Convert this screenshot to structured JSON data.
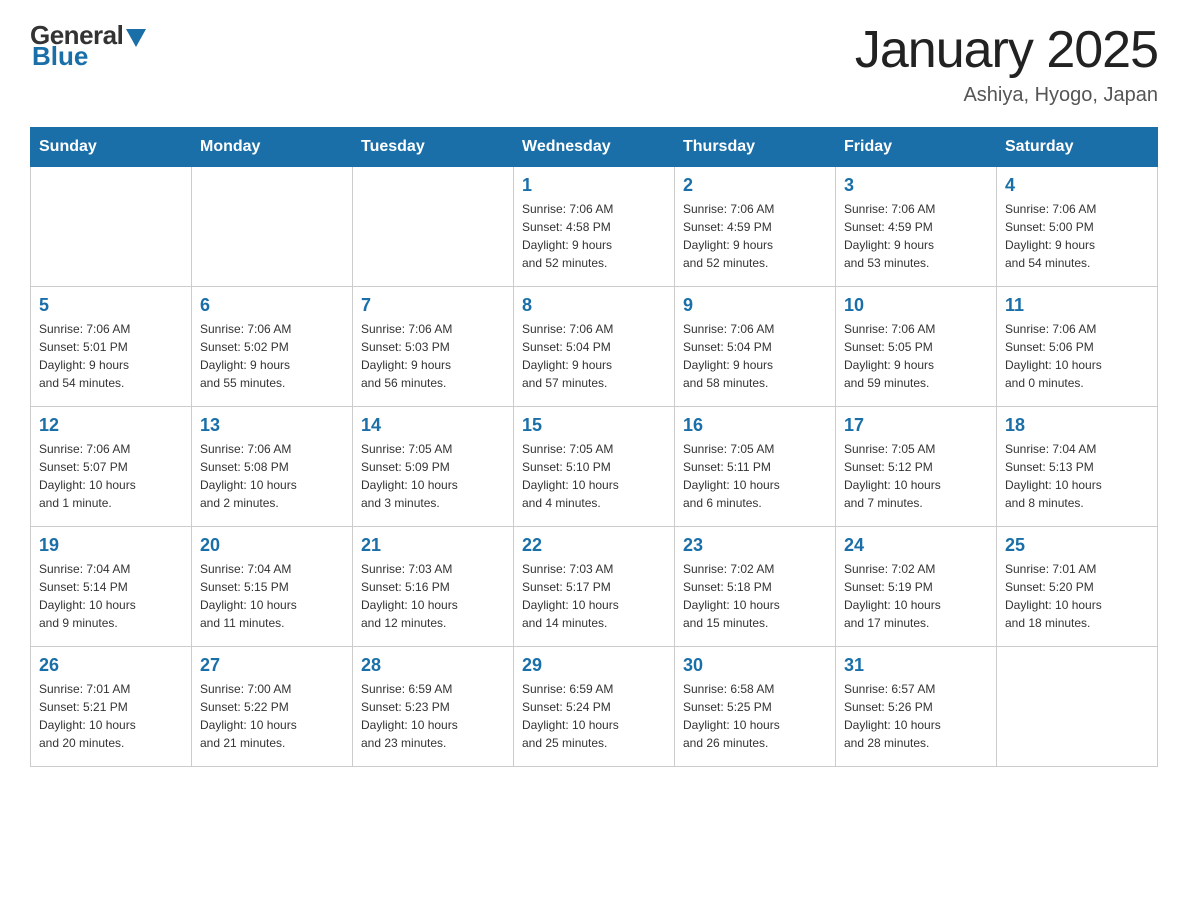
{
  "header": {
    "logo_general": "General",
    "logo_blue": "Blue",
    "main_title": "January 2025",
    "subtitle": "Ashiya, Hyogo, Japan"
  },
  "days": [
    "Sunday",
    "Monday",
    "Tuesday",
    "Wednesday",
    "Thursday",
    "Friday",
    "Saturday"
  ],
  "rows": [
    [
      {
        "date": "",
        "info": ""
      },
      {
        "date": "",
        "info": ""
      },
      {
        "date": "",
        "info": ""
      },
      {
        "date": "1",
        "info": "Sunrise: 7:06 AM\nSunset: 4:58 PM\nDaylight: 9 hours\nand 52 minutes."
      },
      {
        "date": "2",
        "info": "Sunrise: 7:06 AM\nSunset: 4:59 PM\nDaylight: 9 hours\nand 52 minutes."
      },
      {
        "date": "3",
        "info": "Sunrise: 7:06 AM\nSunset: 4:59 PM\nDaylight: 9 hours\nand 53 minutes."
      },
      {
        "date": "4",
        "info": "Sunrise: 7:06 AM\nSunset: 5:00 PM\nDaylight: 9 hours\nand 54 minutes."
      }
    ],
    [
      {
        "date": "5",
        "info": "Sunrise: 7:06 AM\nSunset: 5:01 PM\nDaylight: 9 hours\nand 54 minutes."
      },
      {
        "date": "6",
        "info": "Sunrise: 7:06 AM\nSunset: 5:02 PM\nDaylight: 9 hours\nand 55 minutes."
      },
      {
        "date": "7",
        "info": "Sunrise: 7:06 AM\nSunset: 5:03 PM\nDaylight: 9 hours\nand 56 minutes."
      },
      {
        "date": "8",
        "info": "Sunrise: 7:06 AM\nSunset: 5:04 PM\nDaylight: 9 hours\nand 57 minutes."
      },
      {
        "date": "9",
        "info": "Sunrise: 7:06 AM\nSunset: 5:04 PM\nDaylight: 9 hours\nand 58 minutes."
      },
      {
        "date": "10",
        "info": "Sunrise: 7:06 AM\nSunset: 5:05 PM\nDaylight: 9 hours\nand 59 minutes."
      },
      {
        "date": "11",
        "info": "Sunrise: 7:06 AM\nSunset: 5:06 PM\nDaylight: 10 hours\nand 0 minutes."
      }
    ],
    [
      {
        "date": "12",
        "info": "Sunrise: 7:06 AM\nSunset: 5:07 PM\nDaylight: 10 hours\nand 1 minute."
      },
      {
        "date": "13",
        "info": "Sunrise: 7:06 AM\nSunset: 5:08 PM\nDaylight: 10 hours\nand 2 minutes."
      },
      {
        "date": "14",
        "info": "Sunrise: 7:05 AM\nSunset: 5:09 PM\nDaylight: 10 hours\nand 3 minutes."
      },
      {
        "date": "15",
        "info": "Sunrise: 7:05 AM\nSunset: 5:10 PM\nDaylight: 10 hours\nand 4 minutes."
      },
      {
        "date": "16",
        "info": "Sunrise: 7:05 AM\nSunset: 5:11 PM\nDaylight: 10 hours\nand 6 minutes."
      },
      {
        "date": "17",
        "info": "Sunrise: 7:05 AM\nSunset: 5:12 PM\nDaylight: 10 hours\nand 7 minutes."
      },
      {
        "date": "18",
        "info": "Sunrise: 7:04 AM\nSunset: 5:13 PM\nDaylight: 10 hours\nand 8 minutes."
      }
    ],
    [
      {
        "date": "19",
        "info": "Sunrise: 7:04 AM\nSunset: 5:14 PM\nDaylight: 10 hours\nand 9 minutes."
      },
      {
        "date": "20",
        "info": "Sunrise: 7:04 AM\nSunset: 5:15 PM\nDaylight: 10 hours\nand 11 minutes."
      },
      {
        "date": "21",
        "info": "Sunrise: 7:03 AM\nSunset: 5:16 PM\nDaylight: 10 hours\nand 12 minutes."
      },
      {
        "date": "22",
        "info": "Sunrise: 7:03 AM\nSunset: 5:17 PM\nDaylight: 10 hours\nand 14 minutes."
      },
      {
        "date": "23",
        "info": "Sunrise: 7:02 AM\nSunset: 5:18 PM\nDaylight: 10 hours\nand 15 minutes."
      },
      {
        "date": "24",
        "info": "Sunrise: 7:02 AM\nSunset: 5:19 PM\nDaylight: 10 hours\nand 17 minutes."
      },
      {
        "date": "25",
        "info": "Sunrise: 7:01 AM\nSunset: 5:20 PM\nDaylight: 10 hours\nand 18 minutes."
      }
    ],
    [
      {
        "date": "26",
        "info": "Sunrise: 7:01 AM\nSunset: 5:21 PM\nDaylight: 10 hours\nand 20 minutes."
      },
      {
        "date": "27",
        "info": "Sunrise: 7:00 AM\nSunset: 5:22 PM\nDaylight: 10 hours\nand 21 minutes."
      },
      {
        "date": "28",
        "info": "Sunrise: 6:59 AM\nSunset: 5:23 PM\nDaylight: 10 hours\nand 23 minutes."
      },
      {
        "date": "29",
        "info": "Sunrise: 6:59 AM\nSunset: 5:24 PM\nDaylight: 10 hours\nand 25 minutes."
      },
      {
        "date": "30",
        "info": "Sunrise: 6:58 AM\nSunset: 5:25 PM\nDaylight: 10 hours\nand 26 minutes."
      },
      {
        "date": "31",
        "info": "Sunrise: 6:57 AM\nSunset: 5:26 PM\nDaylight: 10 hours\nand 28 minutes."
      },
      {
        "date": "",
        "info": ""
      }
    ]
  ]
}
